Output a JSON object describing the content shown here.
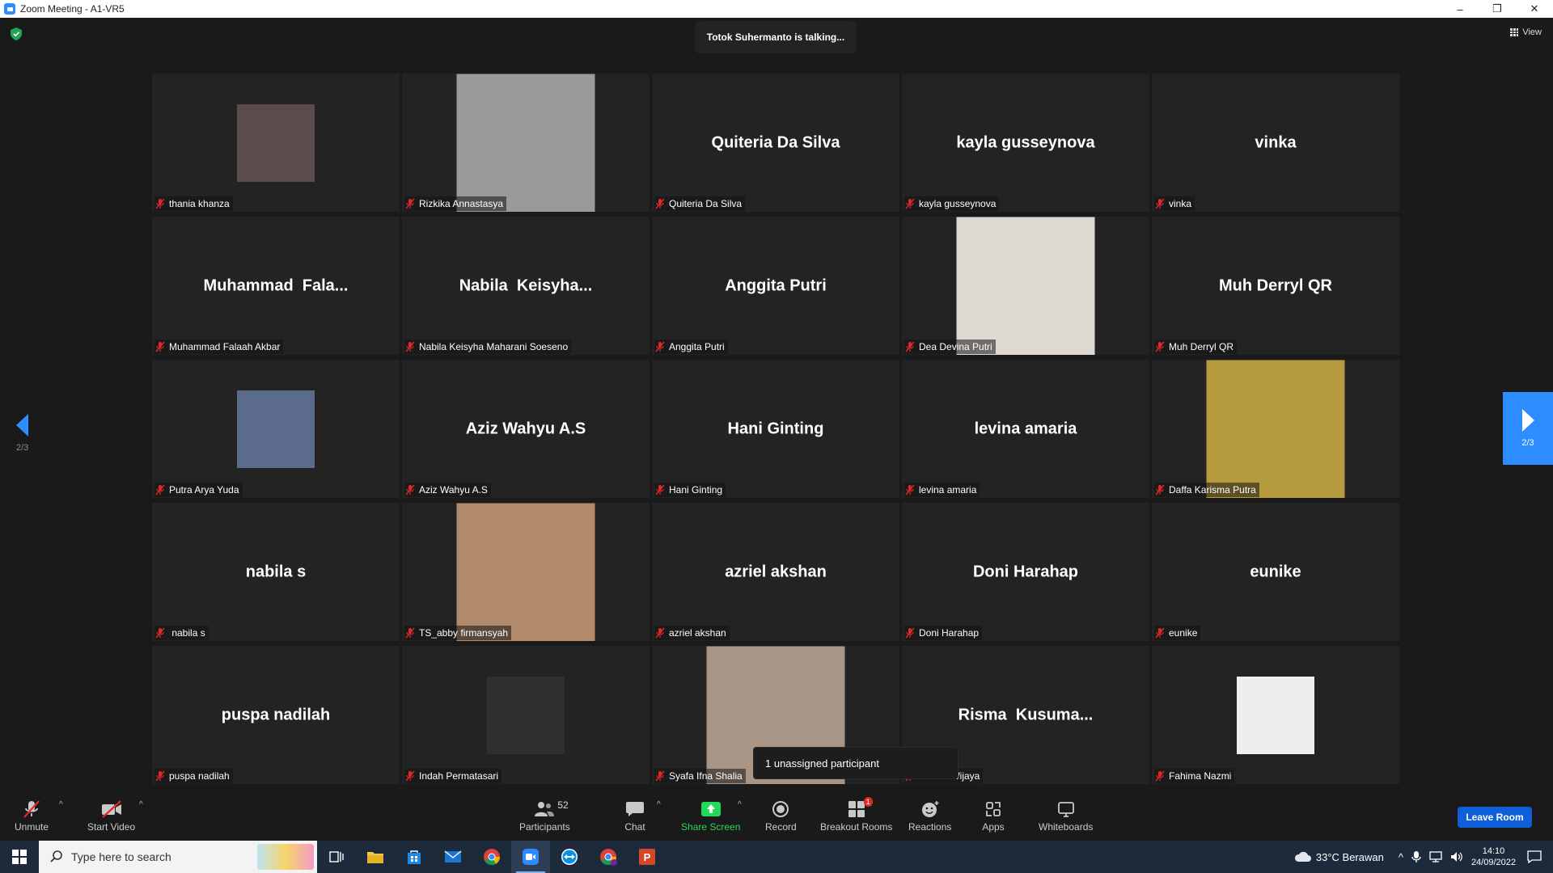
{
  "window": {
    "title": "Zoom Meeting - A1-VR5",
    "minimize": "–",
    "restore": "❐",
    "close": "✕"
  },
  "header": {
    "talking": "Totok Suhermanto is talking...",
    "view_label": "View"
  },
  "pagination": {
    "left_page": "2/3",
    "right_page": "2/3"
  },
  "participants": [
    {
      "name": "thania khanza",
      "display": "",
      "photo": "small",
      "photo_color": "#5b4b4a"
    },
    {
      "name": "Rizkika Annastasya",
      "display": "",
      "photo": "large",
      "photo_color": "#9a9a9a"
    },
    {
      "name": "Quiteria Da Silva",
      "display": "Quiteria Da Silva"
    },
    {
      "name": "kayla gusseynova",
      "display": "kayla gusseynova"
    },
    {
      "name": "vinka",
      "display": "vinka"
    },
    {
      "name": "Muhammad Falaah Akbar",
      "display": "Muhammad  Fala..."
    },
    {
      "name": "Nabila Keisyha Maharani Soeseno",
      "display": "Nabila  Keisyha..."
    },
    {
      "name": "Anggita Putri",
      "display": "Anggita Putri"
    },
    {
      "name": "Dea Devina Putri",
      "display": "",
      "photo": "large",
      "photo_color": "#ddd8d2"
    },
    {
      "name": "Muh Derryl QR",
      "display": "Muh Derryl QR"
    },
    {
      "name": "Putra Arya Yuda",
      "display": "",
      "photo": "small",
      "photo_color": "#5a6b8c"
    },
    {
      "name": "Aziz Wahyu A.S",
      "display": "Aziz Wahyu A.S"
    },
    {
      "name": "Hani Ginting",
      "display": "Hani Ginting"
    },
    {
      "name": "levina amaria",
      "display": "levina amaria"
    },
    {
      "name": "Daffa Karisma Putra",
      "display": "",
      "photo": "large",
      "photo_color": "#b59a3e"
    },
    {
      "name": " nabila s",
      "display": "nabila s"
    },
    {
      "name": "TS_abby firmansyah",
      "display": "",
      "photo": "large",
      "photo_color": "#b08a6a"
    },
    {
      "name": "azriel akshan",
      "display": "azriel akshan"
    },
    {
      "name": "Doni Harahap",
      "display": "Doni Harahap"
    },
    {
      "name": "eunike",
      "display": "eunike"
    },
    {
      "name": "puspa nadilah",
      "display": "puspa nadilah"
    },
    {
      "name": "Indah Permatasari",
      "display": "",
      "photo": "small",
      "photo_color": "#2f2f2f"
    },
    {
      "name": "Syafa Ifna Shalia",
      "display": "",
      "photo": "large",
      "photo_color": "#a89585"
    },
    {
      "name": "usuma Wijaya",
      "display": "Risma  Kusuma..."
    },
    {
      "name": "Fahima Nazmi",
      "display": "",
      "photo": "small",
      "photo_color": "#eeeeee"
    }
  ],
  "tooltip": {
    "text": "1 unassigned participant"
  },
  "toolbar": {
    "unmute": "Unmute",
    "start_video": "Start Video",
    "participants": "Participants",
    "participants_count": "52",
    "chat": "Chat",
    "share_screen": "Share Screen",
    "record": "Record",
    "breakout_rooms": "Breakout Rooms",
    "breakout_badge": "1",
    "reactions": "Reactions",
    "apps": "Apps",
    "whiteboards": "Whiteboards",
    "leave": "Leave Room"
  },
  "taskbar": {
    "search_placeholder": "Type here to search",
    "weather": "33°C  Berawan",
    "time": "14:10",
    "date": "24/09/2022"
  },
  "colors": {
    "accent": "#2d8cff",
    "mute_red": "#e02828",
    "share_green": "#23d959"
  }
}
